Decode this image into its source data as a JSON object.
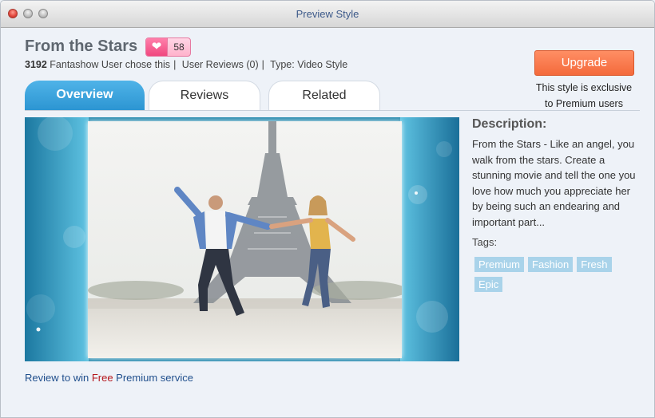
{
  "window": {
    "title": "Preview Style"
  },
  "style": {
    "title": "From the Stars",
    "likes": "58",
    "user_count": "3192",
    "user_text": "Fantashow User chose this",
    "reviews_text": "User Reviews (0)",
    "type_text": "Type: Video Style"
  },
  "upgrade": {
    "button_label": "Upgrade",
    "note_line1": "This style is exclusive",
    "note_line2": "to Premium users"
  },
  "tabs": [
    {
      "label": "Overview",
      "active": true
    },
    {
      "label": "Reviews",
      "active": false
    },
    {
      "label": "Related",
      "active": false
    }
  ],
  "review_link": {
    "prefix": "Review to win ",
    "free": "Free",
    "suffix": " Premium service"
  },
  "description": {
    "title": "Description:",
    "text": "From the Stars - Like an angel, you walk from the stars. Create a stunning movie and tell the one you love how much you appreciate her by being such an endearing and important part...",
    "tags_label": "Tags:",
    "tags": [
      "Premium",
      "Fashion",
      "Fresh",
      "Epic"
    ]
  },
  "colors": {
    "accent_tab": "#2c95d2",
    "upgrade": "#f46a3b",
    "tag": "#a9d3ea",
    "link": "#1f4e8c",
    "free": "#b5171d"
  }
}
